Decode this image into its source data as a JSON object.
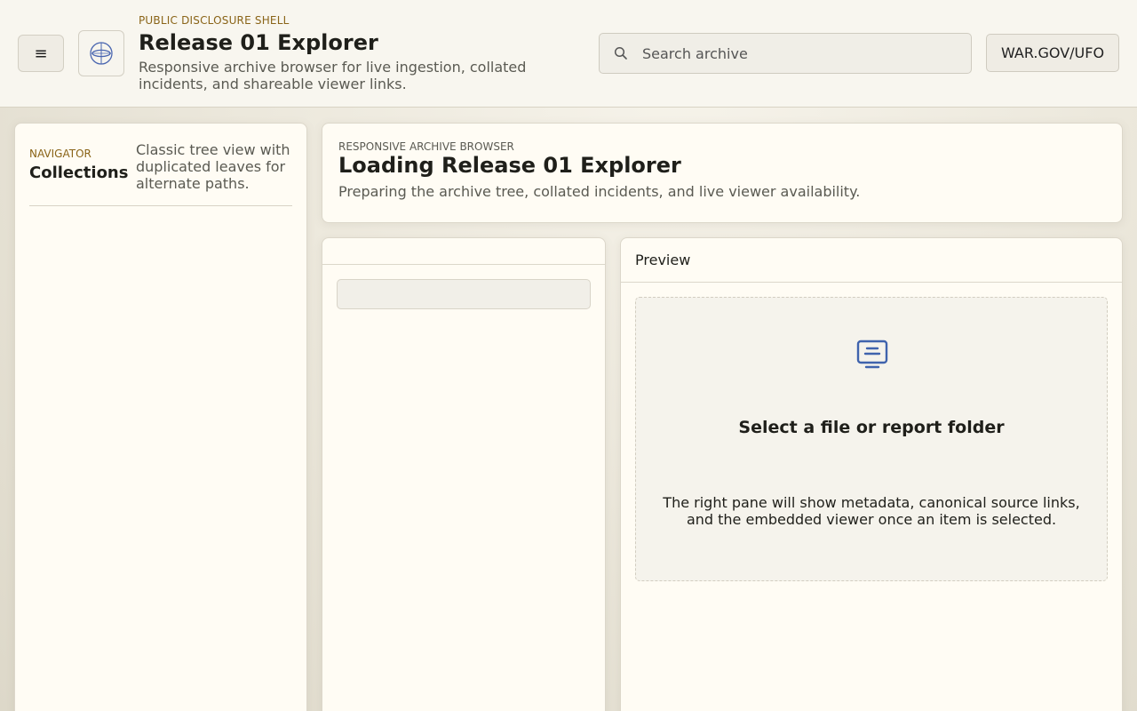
{
  "header": {
    "menu_icon": "hamburger-icon",
    "logo_icon": "globe-orbit-icon",
    "kicker": "PUBLIC DISCLOSURE SHELL",
    "title": "Release 01 Explorer",
    "subtitle": "Responsive archive browser for live ingestion, collated incidents, and shareable viewer links.",
    "search": {
      "placeholder": "Search archive",
      "value": "",
      "icon": "search-icon"
    },
    "link_button": "WAR.GOV/UFO"
  },
  "navigator": {
    "kicker": "NAVIGATOR",
    "title": "Collections",
    "description": "Classic tree view with duplicated leaves for alternate paths."
  },
  "loading": {
    "kicker": "RESPONSIVE ARCHIVE BROWSER",
    "title": "Loading Release 01 Explorer",
    "subtitle": "Preparing the archive tree, collated incidents, and live viewer availability."
  },
  "list": {
    "header": ""
  },
  "preview": {
    "header": "Preview",
    "empty_icon": "monitor-document-icon",
    "empty_title": "Select a file or report folder",
    "empty_text": "The right pane will show metadata, canonical source links, and the embedded viewer once an item is selected."
  },
  "colors": {
    "accent_gold": "#8a6418",
    "icon_blue": "#3f63ad",
    "panel_bg": "#fffcf4"
  }
}
